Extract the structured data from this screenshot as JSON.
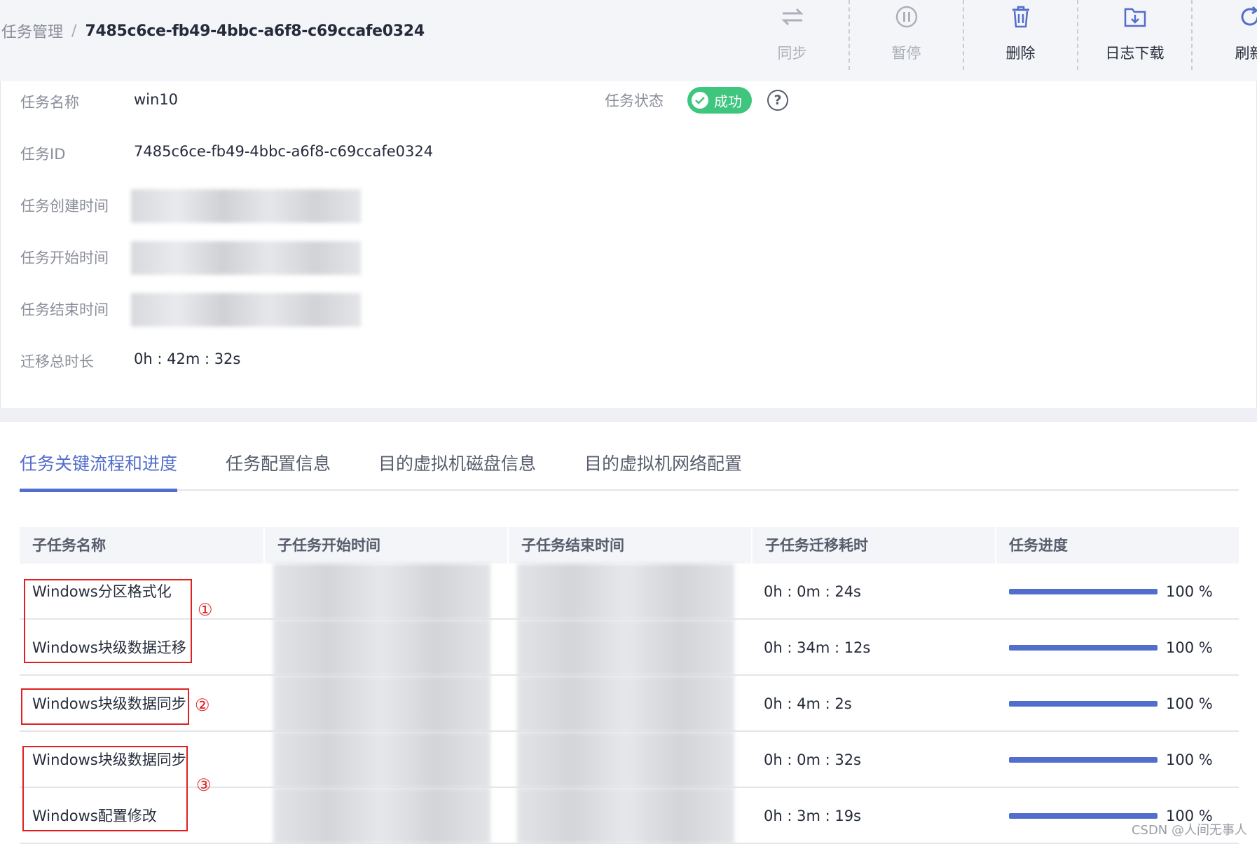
{
  "breadcrumb": {
    "root": "任务管理",
    "separator": "/",
    "current": "7485c6ce-fb49-4bbc-a6f8-c69ccafe0324"
  },
  "toolbar": {
    "sync": {
      "label": "同步",
      "icon": "sync-arrows-icon"
    },
    "pause": {
      "label": "暂停",
      "icon": "pause-circle-icon"
    },
    "delete": {
      "label": "删除",
      "icon": "trash-icon"
    },
    "download_log": {
      "label": "日志下载",
      "icon": "folder-download-icon"
    },
    "refresh": {
      "label": "刷新",
      "icon": "refresh-icon"
    }
  },
  "info": {
    "name_label": "任务名称",
    "name_value": "win10",
    "status_label": "任务状态",
    "status_value": "成功",
    "status_color": "#3ec57e",
    "id_label": "任务ID",
    "id_value": "7485c6ce-fb49-4bbc-a6f8-c69ccafe0324",
    "created_label": "任务创建时间",
    "start_label": "任务开始时间",
    "end_label": "任务结束时间",
    "duration_label": "迁移总时长",
    "duration_value": "0h : 42m : 32s"
  },
  "tabs": [
    {
      "label": "任务关键流程和进度",
      "active": true
    },
    {
      "label": "任务配置信息",
      "active": false
    },
    {
      "label": "目的虚拟机磁盘信息",
      "active": false
    },
    {
      "label": "目的虚拟机网络配置",
      "active": false
    }
  ],
  "table": {
    "headers": [
      "子任务名称",
      "子任务开始时间",
      "子任务结束时间",
      "子任务迁移耗时",
      "任务进度"
    ],
    "rows": [
      {
        "name": "Windows分区格式化",
        "duration": "0h : 0m : 24s",
        "progress": "100 %",
        "progress_value": 100
      },
      {
        "name": "Windows块级数据迁移",
        "duration": "0h : 34m : 12s",
        "progress": "100 %",
        "progress_value": 100
      },
      {
        "name": "Windows块级数据同步",
        "duration": "0h : 4m : 2s",
        "progress": "100 %",
        "progress_value": 100
      },
      {
        "name": "Windows块级数据同步",
        "duration": "0h : 0m : 32s",
        "progress": "100 %",
        "progress_value": 100
      },
      {
        "name": "Windows配置修改",
        "duration": "0h : 3m : 19s",
        "progress": "100 %",
        "progress_value": 100
      }
    ]
  },
  "annotations": {
    "marker_1": "①",
    "marker_2": "②",
    "marker_3": "③"
  },
  "watermark": "CSDN @人间无事人",
  "colors": {
    "accent": "#526ecc",
    "success": "#3ec57e",
    "annotation": "#e02020"
  }
}
